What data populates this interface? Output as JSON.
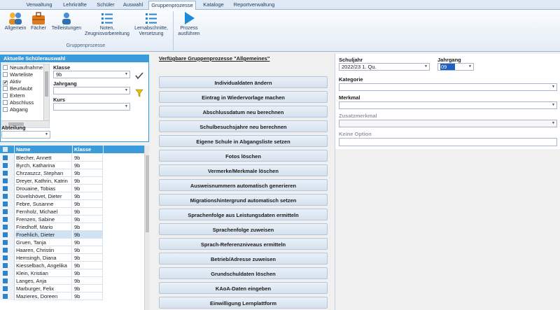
{
  "menu": {
    "tabs": [
      "Verwaltung",
      "Lehrkräfte",
      "Schüler",
      "Auswahl",
      "Gruppenprozesse",
      "Kataloge",
      "Reportverwaltung"
    ]
  },
  "ribbon": {
    "buttons": [
      {
        "label": "Allgemein",
        "icon": "people-icon"
      },
      {
        "label": "Fächer",
        "icon": "briefcase-icon"
      },
      {
        "label": "Teilleistungen",
        "icon": "user-group-icon"
      },
      {
        "label": "Noten, Zeugnisvorbereitung",
        "icon": "list-icon"
      },
      {
        "label": "Lernabschnitte, Versetzung",
        "icon": "list-icon"
      },
      {
        "label": "Prozess ausführen",
        "icon": "play-icon"
      }
    ],
    "group_label": "Gruppenprozesse"
  },
  "selection": {
    "title": "Aktuelle Schülerauswahl",
    "statuses": [
      {
        "label": "Neuaufnahme",
        "checked": false
      },
      {
        "label": "Warteliste",
        "checked": false
      },
      {
        "label": "Aktiv",
        "checked": true
      },
      {
        "label": "Beurlaubt",
        "checked": false
      },
      {
        "label": "Extern",
        "checked": false
      },
      {
        "label": "Abschluss",
        "checked": false
      },
      {
        "label": "Abgang",
        "checked": false
      }
    ],
    "klasse_label": "Klasse",
    "klasse_value": "9b",
    "jahrgang_label": "Jahrgang",
    "jahrgang_value": "",
    "kurs_label": "Kurs",
    "kurs_value": "",
    "abteilung_label": "Abteilung",
    "abteilung_value": ""
  },
  "students": {
    "columns": [
      "Name",
      "Klasse"
    ],
    "rows": [
      {
        "name": "Blecher, Annett",
        "klasse": "9b"
      },
      {
        "name": "Byrch, Katharina",
        "klasse": "9b"
      },
      {
        "name": "Chrzaszcz, Stephan",
        "klasse": "9b"
      },
      {
        "name": "Dreyer, Kathrin, Katrin",
        "klasse": "9b"
      },
      {
        "name": "Drouaine, Tobias",
        "klasse": "9b"
      },
      {
        "name": "Düvelshövet, Dieter",
        "klasse": "9b"
      },
      {
        "name": "Febre, Susanne",
        "klasse": "9b"
      },
      {
        "name": "Fernholz, Michael",
        "klasse": "9b"
      },
      {
        "name": "Frenzen, Sabine",
        "klasse": "9b"
      },
      {
        "name": "Friedhoff, Mario",
        "klasse": "9b"
      },
      {
        "name": "Froehlich, Dieter",
        "klasse": "9b"
      },
      {
        "name": "Gruen, Tanja",
        "klasse": "9b"
      },
      {
        "name": "Haaren, Christin",
        "klasse": "9b"
      },
      {
        "name": "Hemsingh, Diana",
        "klasse": "9b"
      },
      {
        "name": "Kiesselbach, Angelika",
        "klasse": "9b"
      },
      {
        "name": "Klein, Kristian",
        "klasse": "9b"
      },
      {
        "name": "Langes, Anja",
        "klasse": "9b"
      },
      {
        "name": "Marburger, Felix",
        "klasse": "9b"
      },
      {
        "name": "Mazieres, Doreen",
        "klasse": "9b"
      }
    ],
    "selected_index": 10
  },
  "processes": {
    "title": "Verfügbare Gruppenprozesse \"Allgemeines\"",
    "buttons": [
      "Individualdaten ändern",
      "Eintrag in Wiedervorlage machen",
      "Abschlussdatum neu berechnen",
      "Schulbesuchsjahre neu berechnen",
      "Eigene Schule in Abgangsliste setzen",
      "Fotos löschen",
      "Vermerke/Merkmale löschen",
      "Ausweisnummern automatisch generieren",
      "Migrationshintergrund automatisch setzen",
      "Sprachenfolge aus Leistungsdaten ermitteln",
      "Sprachenfolge zuweisen",
      "Sprach-Referenzniveaus ermitteln",
      "Betrieb/Adresse zuweisen",
      "Grundschuldaten löschen",
      "KAoA-Daten eingeben",
      "Einwilligung Lernplattform"
    ]
  },
  "details": {
    "schuljahr_label": "Schuljahr",
    "schuljahr_value": "2022/23 1. Qu.",
    "jahrgang_label": "Jahrgang",
    "jahrgang_value": "09",
    "kategorie_label": "Kategorie",
    "kategorie_value": "",
    "merkmal_label": "Merkmal",
    "merkmal_value": "",
    "zusatzmerkmal_label": "Zusatzmerkmal",
    "zusatzmerkmal_value": "",
    "option_label": "Keine Option",
    "option_value": ""
  },
  "colors": {
    "accent": "#3b9ad9",
    "selection": "#cfe3f5",
    "highlight": "#1f5fbf"
  }
}
